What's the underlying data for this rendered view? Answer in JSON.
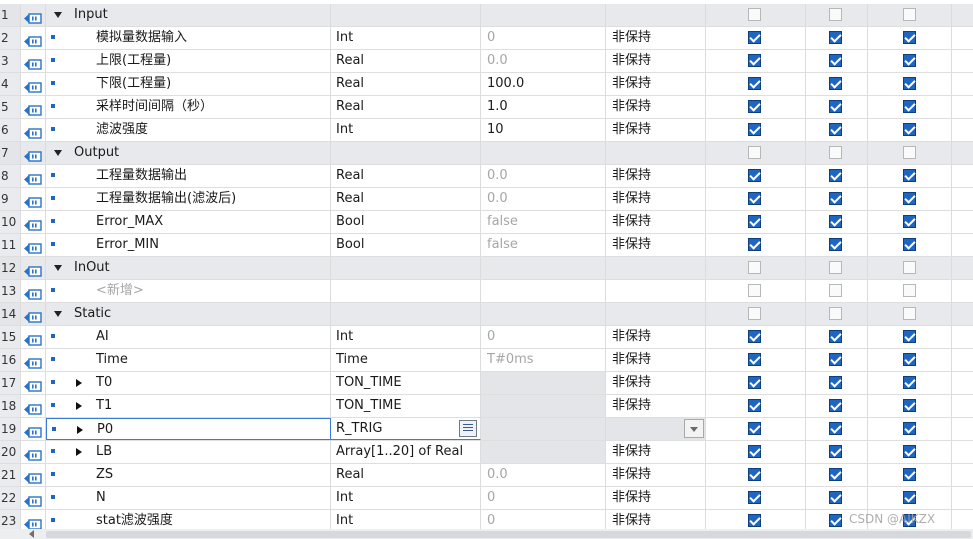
{
  "rows": [
    {
      "num": "1",
      "kind": "section",
      "name": "Input",
      "expander": "down",
      "cb": [
        false,
        false,
        false
      ]
    },
    {
      "num": "2",
      "kind": "var",
      "name": "模拟量数据输入",
      "type": "Int",
      "default": "0",
      "default_grey": true,
      "retain": "非保持",
      "cb": [
        true,
        true,
        true
      ]
    },
    {
      "num": "3",
      "kind": "var",
      "name": "上限(工程量)",
      "type": "Real",
      "default": "0.0",
      "default_grey": true,
      "retain": "非保持",
      "cb": [
        true,
        true,
        true
      ]
    },
    {
      "num": "4",
      "kind": "var",
      "name": "下限(工程量)",
      "type": "Real",
      "default": "100.0",
      "default_grey": false,
      "retain": "非保持",
      "cb": [
        true,
        true,
        true
      ]
    },
    {
      "num": "5",
      "kind": "var",
      "name": "采样时间间隔（秒）",
      "type": "Real",
      "default": "1.0",
      "default_grey": false,
      "retain": "非保持",
      "cb": [
        true,
        true,
        true
      ]
    },
    {
      "num": "6",
      "kind": "var",
      "name": "滤波强度",
      "type": "Int",
      "default": "10",
      "default_grey": false,
      "retain": "非保持",
      "cb": [
        true,
        true,
        true
      ]
    },
    {
      "num": "7",
      "kind": "section",
      "name": "Output",
      "expander": "down",
      "cb": [
        false,
        false,
        false
      ]
    },
    {
      "num": "8",
      "kind": "var",
      "name": "工程量数据输出",
      "type": "Real",
      "default": "0.0",
      "default_grey": true,
      "retain": "非保持",
      "cb": [
        true,
        true,
        true
      ]
    },
    {
      "num": "9",
      "kind": "var",
      "name": "工程量数据输出(滤波后)",
      "type": "Real",
      "default": "0.0",
      "default_grey": true,
      "retain": "非保持",
      "cb": [
        true,
        true,
        true
      ]
    },
    {
      "num": "10",
      "kind": "var",
      "name": "Error_MAX",
      "type": "Bool",
      "default": "false",
      "default_grey": true,
      "retain": "非保持",
      "cb": [
        true,
        true,
        true
      ]
    },
    {
      "num": "11",
      "kind": "var",
      "name": "Error_MIN",
      "type": "Bool",
      "default": "false",
      "default_grey": true,
      "retain": "非保持",
      "cb": [
        true,
        true,
        true
      ]
    },
    {
      "num": "12",
      "kind": "section",
      "name": "InOut",
      "expander": "down",
      "cb": [
        false,
        false,
        false
      ]
    },
    {
      "num": "13",
      "kind": "add",
      "name": "<新增>",
      "cb": [
        false,
        false,
        false
      ]
    },
    {
      "num": "14",
      "kind": "section",
      "name": "Static",
      "expander": "down",
      "cb": [
        false,
        false,
        false
      ]
    },
    {
      "num": "15",
      "kind": "var",
      "name": "AI",
      "type": "Int",
      "default": "0",
      "default_grey": true,
      "retain": "非保持",
      "cb": [
        true,
        true,
        true
      ]
    },
    {
      "num": "16",
      "kind": "var",
      "name": "Time",
      "type": "Time",
      "default": "T#0ms",
      "default_grey": true,
      "retain": "非保持",
      "cb": [
        true,
        true,
        true
      ]
    },
    {
      "num": "17",
      "kind": "struct",
      "name": "T0",
      "type": "TON_TIME",
      "default": "",
      "retain": "非保持",
      "cb": [
        true,
        true,
        true
      ]
    },
    {
      "num": "18",
      "kind": "struct",
      "name": "T1",
      "type": "TON_TIME",
      "default": "",
      "retain": "非保持",
      "cb": [
        true,
        true,
        true
      ]
    },
    {
      "num": "19",
      "kind": "struct",
      "name": "P0",
      "type": "R_TRIG",
      "default": "",
      "retain": "",
      "selected": true,
      "cb": [
        true,
        true,
        true
      ]
    },
    {
      "num": "20",
      "kind": "struct",
      "name": "LB",
      "type": "Array[1..20] of Real",
      "default": "",
      "retain": "非保持",
      "cb": [
        true,
        true,
        true
      ]
    },
    {
      "num": "21",
      "kind": "var",
      "name": "ZS",
      "type": "Real",
      "default": "0.0",
      "default_grey": true,
      "retain": "非保持",
      "cb": [
        true,
        true,
        true
      ]
    },
    {
      "num": "22",
      "kind": "var",
      "name": "N",
      "type": "Int",
      "default": "0",
      "default_grey": true,
      "retain": "非保持",
      "cb": [
        true,
        true,
        true
      ]
    },
    {
      "num": "23",
      "kind": "var",
      "name": "stat滤波强度",
      "type": "Int",
      "default": "0",
      "default_grey": true,
      "retain": "非保持",
      "cb": [
        true,
        true,
        true
      ]
    }
  ],
  "watermark": "CSDN @AIKZX",
  "colors": {
    "accent": "#1f66c2",
    "section_bg": "#e7e9ec",
    "grid_line": "#dedede"
  }
}
